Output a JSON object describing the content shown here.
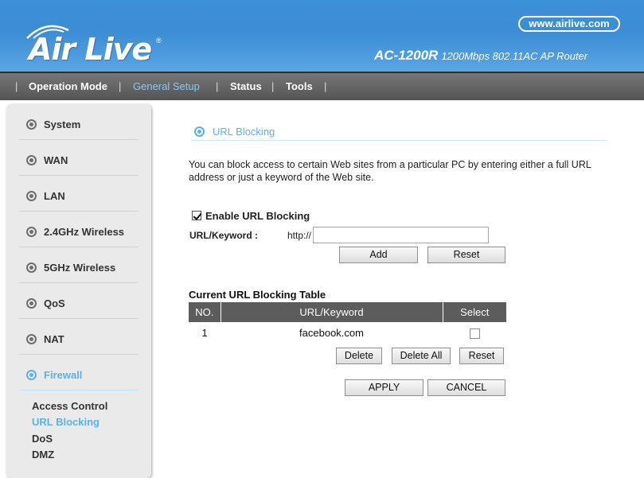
{
  "header": {
    "brand": "Air Live",
    "website": "www.airlive.com",
    "model": "AC-1200R",
    "model_desc": "1200Mbps 802.11AC AP Router"
  },
  "nav": {
    "items": [
      {
        "label": "Operation Mode",
        "active": false
      },
      {
        "label": "General Setup",
        "active": true
      },
      {
        "label": "Status",
        "active": false
      },
      {
        "label": "Tools",
        "active": false
      }
    ]
  },
  "sidebar": {
    "items": [
      {
        "label": "System",
        "icon": "circle-icon"
      },
      {
        "label": "WAN",
        "icon": "circle-icon"
      },
      {
        "label": "LAN",
        "icon": "circle-icon"
      },
      {
        "label": "2.4GHz Wireless",
        "icon": "circle-icon"
      },
      {
        "label": "5GHz Wireless",
        "icon": "circle-icon"
      },
      {
        "label": "QoS",
        "icon": "circle-icon"
      },
      {
        "label": "NAT",
        "icon": "circle-icon"
      },
      {
        "label": "Firewall",
        "icon": "circle-icon",
        "active": true
      }
    ],
    "sub_items": [
      {
        "label": "Access Control"
      },
      {
        "label": "URL Blocking",
        "active": true
      },
      {
        "label": "DoS"
      },
      {
        "label": "DMZ"
      }
    ]
  },
  "main": {
    "section_title": "URL Blocking",
    "description": "You can block access to certain Web sites from a particular PC by entering either a full URL address or just a keyword of the Web site.",
    "enable_label": "Enable URL Blocking",
    "enable_checked": true,
    "keyword_label": "URL/Keyword :",
    "url_prefix": "http://",
    "url_value": "",
    "add_label": "Add",
    "reset_label": "Reset",
    "table_title": "Current URL Blocking Table",
    "table_headers": [
      "NO.",
      "URL/Keyword",
      "Select"
    ],
    "table_rows": [
      {
        "no": "1",
        "keyword": "facebook.com",
        "selected": false
      }
    ],
    "delete_label": "Delete",
    "delete_all_label": "Delete All",
    "table_reset_label": "Reset",
    "apply_label": "APPLY",
    "cancel_label": "CANCEL"
  },
  "colors": {
    "header_blue": "#3d8fd6",
    "nav_gray": "#5e5e5e",
    "accent": "#5bb2e7",
    "table_header": "#5c5c5c"
  }
}
